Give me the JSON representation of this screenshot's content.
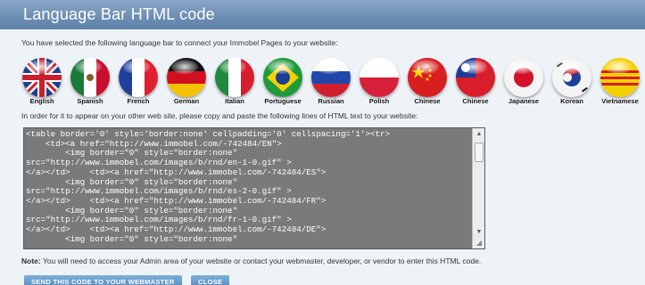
{
  "header": {
    "title": "Language Bar HTML code"
  },
  "intro_text": "You have selected the following language bar to connect your Immobel Pages to your website:",
  "flags": [
    {
      "label": "English",
      "icon": "uk-flag-icon"
    },
    {
      "label": "Spanish",
      "icon": "mexico-flag-icon"
    },
    {
      "label": "French",
      "icon": "france-flag-icon"
    },
    {
      "label": "German",
      "icon": "germany-flag-icon"
    },
    {
      "label": "Italian",
      "icon": "italy-flag-icon"
    },
    {
      "label": "Portuguese",
      "icon": "brazil-flag-icon"
    },
    {
      "label": "Russian",
      "icon": "russia-flag-icon"
    },
    {
      "label": "Polish",
      "icon": "poland-flag-icon"
    },
    {
      "label": "Chinese",
      "icon": "china-flag-icon"
    },
    {
      "label": "Chinese",
      "icon": "taiwan-flag-icon"
    },
    {
      "label": "Japanese",
      "icon": "japan-flag-icon"
    },
    {
      "label": "Korean",
      "icon": "korea-flag-icon"
    },
    {
      "label": "Vietnamese",
      "icon": "vietnam-flag-icon"
    }
  ],
  "instruction_text": "In order for it to appear on your other web site, please copy and paste the following lines of HTML text to your website:",
  "code_lines": [
    "<table border='0' style='border:none' cellpadding='0' cellspacing='1'><tr>",
    "    <td><a href=\"http://www.immobel.com/-742484/EN\">",
    "        <img border=\"0\" style=\"border:none\"",
    "src=\"http://www.immobel.com/images/b/rnd/en-1-0.gif\" >",
    "</a></td>    <td><a href=\"http://www.immobel.com/-742484/ES\">",
    "        <img border=\"0\" style=\"border:none\"",
    "src=\"http://www.immobel.com/images/b/rnd/es-2-0.gif\" >",
    "</a></td>    <td><a href=\"http://www.immobel.com/-742484/FR\">",
    "        <img border=\"0\" style=\"border:none\"",
    "src=\"http://www.immobel.com/images/b/rnd/fr-1-0.gif\" >",
    "</a></td>    <td><a href=\"http://www.immobel.com/-742484/DE\">",
    "        <img border=\"0\" style=\"border:none\""
  ],
  "note": {
    "prefix": "Note:",
    "text": " You will need to access your Admin area of your website or contact your webmaster, developer, or vendor to enter this HTML code."
  },
  "buttons": {
    "send": "SEND THIS CODE TO YOUR WEBMASTER",
    "close": "CLOSE"
  },
  "colors": {
    "title_bar": "#6e8fb4",
    "panel_bg": "#eef3f8",
    "code_bg": "#7a7a7a",
    "button": "#4f87bd"
  }
}
